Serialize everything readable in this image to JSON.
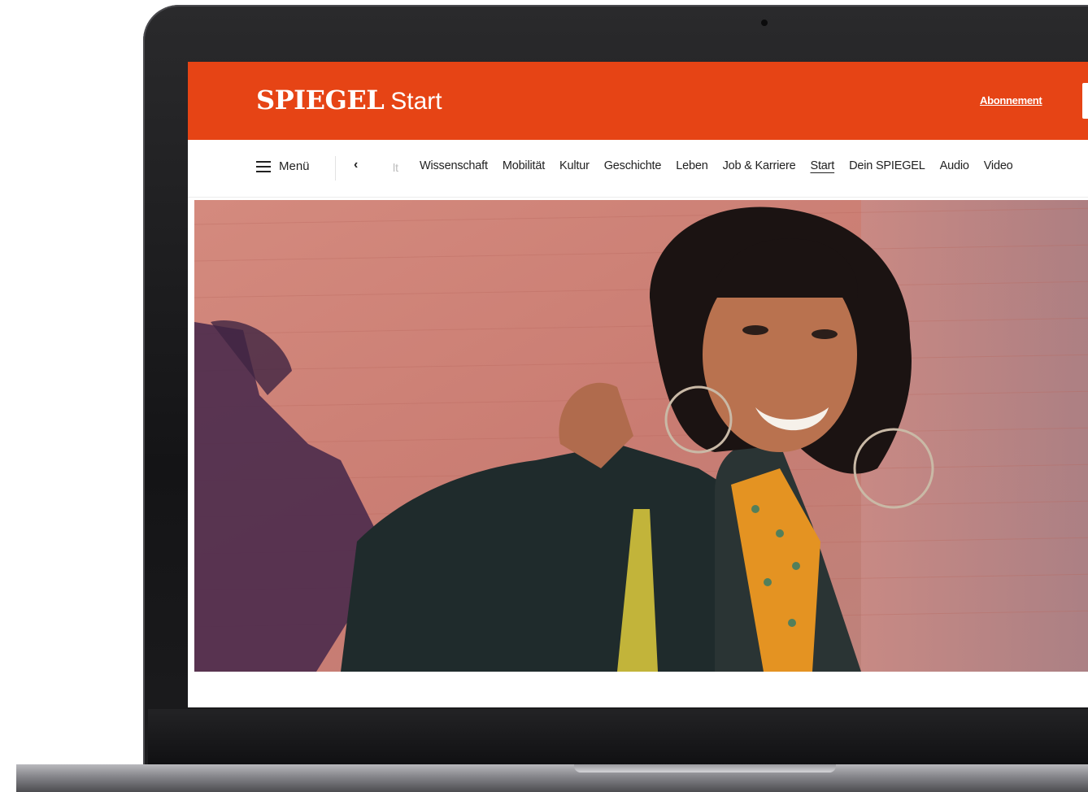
{
  "header": {
    "brand": "SPIEGEL",
    "section": "Start",
    "subscription_link": "Abonnement"
  },
  "nav": {
    "menu_label": "Menü",
    "prev_icon": "chevron-left-icon",
    "faded_item": "lt",
    "items": [
      {
        "label": "Wissenschaft",
        "active": false
      },
      {
        "label": "Mobilität",
        "active": false
      },
      {
        "label": "Kultur",
        "active": false
      },
      {
        "label": "Geschichte",
        "active": false
      },
      {
        "label": "Leben",
        "active": false
      },
      {
        "label": "Job & Karriere",
        "active": false
      },
      {
        "label": "Start",
        "active": true
      },
      {
        "label": "Dein SPIEGEL",
        "active": false
      },
      {
        "label": "Audio",
        "active": false
      },
      {
        "label": "Video",
        "active": false
      }
    ]
  },
  "colors": {
    "brand_orange": "#e64415",
    "nav_text": "#222222"
  }
}
